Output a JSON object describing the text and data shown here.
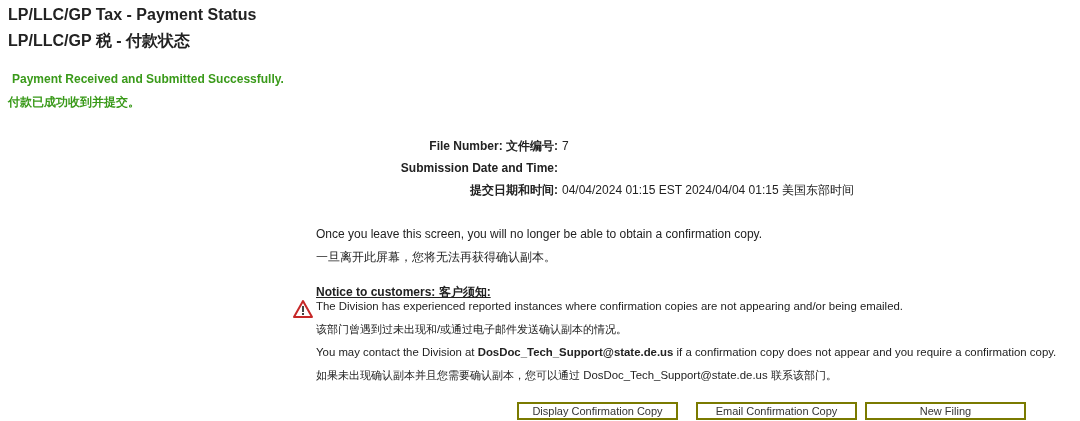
{
  "titles": [
    "LP/LLC/GP Tax - Payment Status",
    "LP/LLC/GP 税 - 付款状态"
  ],
  "status_messages": [
    "Payment Received and Submitted Successfully.",
    "付款已成功收到并提交。"
  ],
  "details": [
    {
      "label": "File Number: 文件编号:",
      "value": "7"
    },
    {
      "label": "Submission Date and Time:"
    },
    {
      "label": "提交日期和时间:",
      "value": "04/04/2024 01:15 EST 2024/04/04 01:15 美国东部时间"
    }
  ],
  "leave_notice": [
    "Once you leave this screen, you will no longer be able to obtain a confirmation copy.",
    "一旦离开此屏幕，您将无法再获得确认副本。"
  ],
  "customer_notice": {
    "heading": "Notice to customers: 客户须知:",
    "lines": [
      "The Division has experienced reported instances where confirmation copies are not appearing and/or being emailed.",
      "该部门曾遇到过未出现和/或通过电子邮件发送确认副本的情况。",
      "You may contact the Division at **DosDoc_Tech_Support@state.de.us** if a confirmation copy does not appear and you require a confirmation copy.",
      "如果未出现确认副本并且您需要确认副本，您可以通过 DosDoc_Tech_Support@state.de.us 联系该部门。"
    ]
  },
  "buttons": [
    "Display Confirmation Copy",
    "Email Confirmation Copy",
    "New Filing"
  ]
}
